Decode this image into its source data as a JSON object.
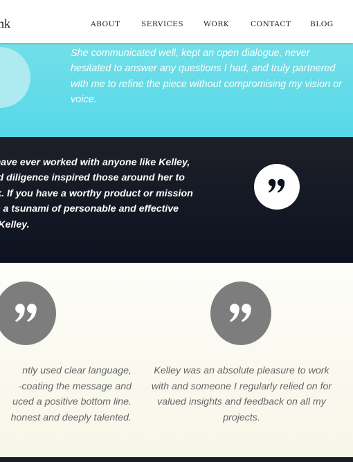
{
  "header": {
    "logo_text": "nk",
    "nav": [
      {
        "label": "ABOUT"
      },
      {
        "label": "SERVICES"
      },
      {
        "label": "WORK"
      },
      {
        "label": "CONTACT"
      },
      {
        "label": "BLOG"
      }
    ]
  },
  "testimonials": {
    "cyan_quote": "She communicated well, kept an open dialogue, never hesitated to answer any questions I had, and truly partnered with me to refine the piece without compromising my vision or voice.",
    "dark_quote": "u have ever worked with anyone like Kelley,\n and diligence inspired those around her to\nork. If you have a worthy product or mission\nate a tsunami of personable and effective\nto Kelley.",
    "left_quote": "ntly used clear language,\n-coating the message and\nuced a positive bottom line.\nhonest and deeply talented.",
    "right_quote": "Kelley was an absolute pleasure to work\nwith and someone I regularly relied on for\nvalued insights and feedback on all my\nprojects."
  },
  "colors": {
    "cyan": "#5ddbe8",
    "dark": "#141a26",
    "grey_circle": "#7d7d7d"
  },
  "icons": [
    "quote-icon"
  ]
}
